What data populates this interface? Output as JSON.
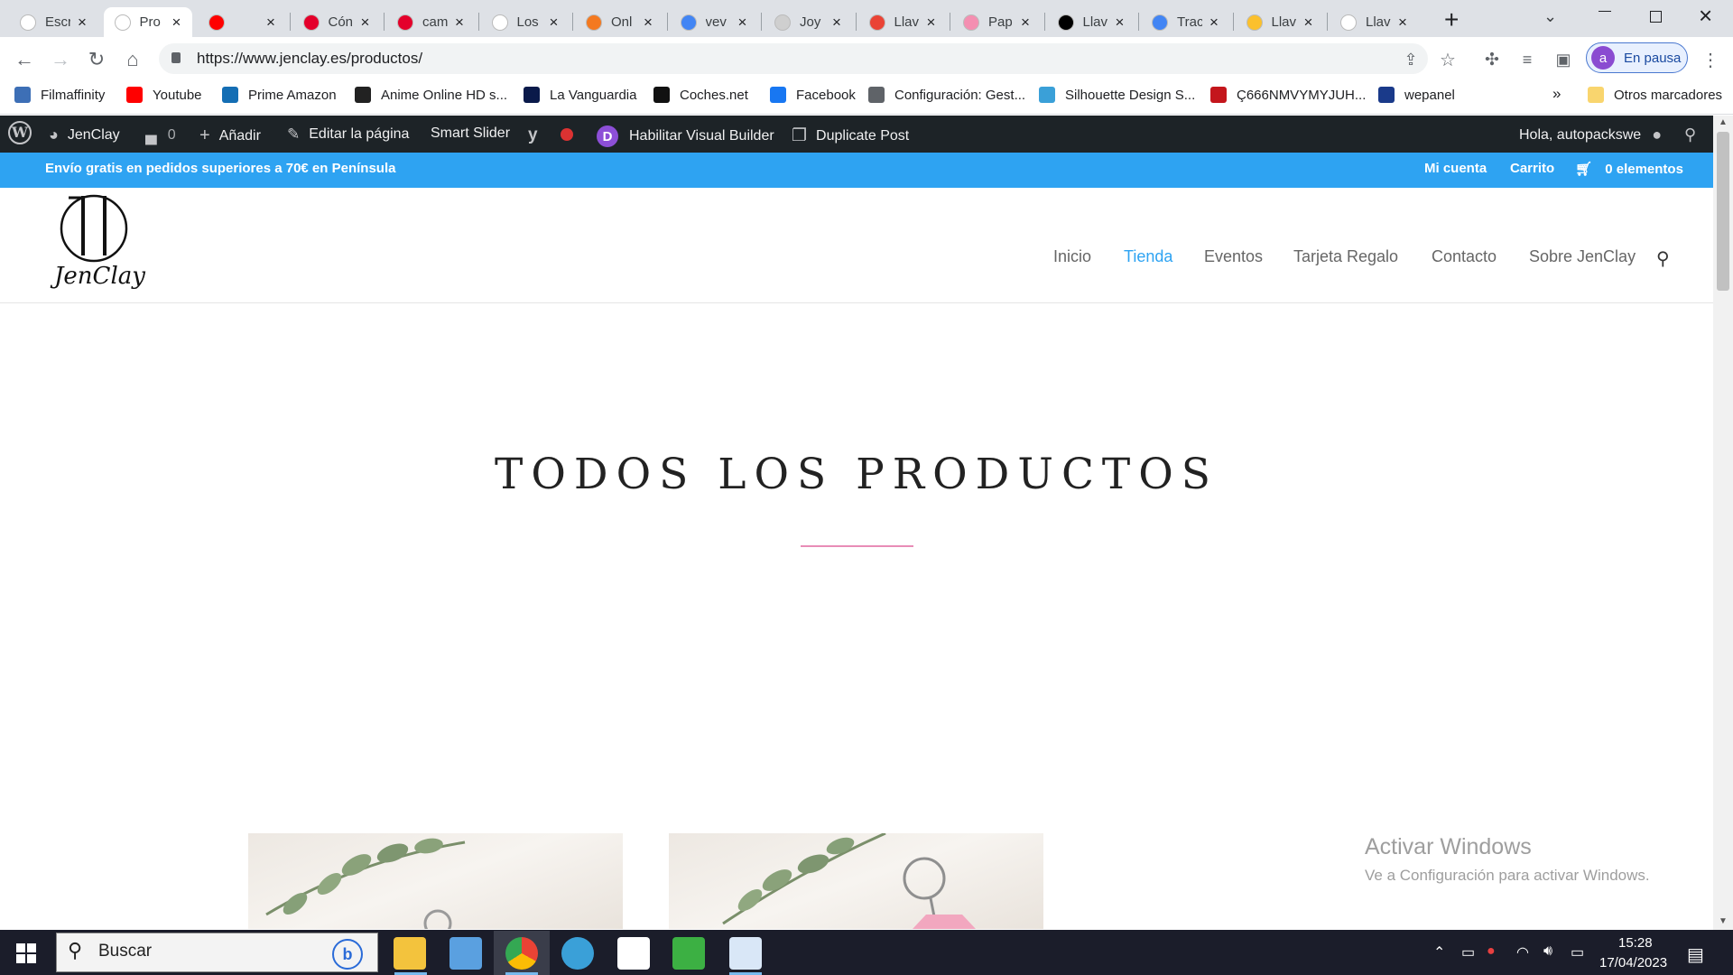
{
  "browser": {
    "tabs": [
      {
        "title": "Escr",
        "color": "#ffffff",
        "active": false
      },
      {
        "title": "Pro",
        "color": "#ffffff",
        "active": true
      },
      {
        "title": "",
        "color": "#ff0000",
        "active": false
      },
      {
        "title": "Cón",
        "color": "#e4002b",
        "active": false
      },
      {
        "title": "cam",
        "color": "#e4002b",
        "active": false
      },
      {
        "title": "Los",
        "color": "#ffffff",
        "active": false
      },
      {
        "title": "Onl",
        "color": "#f47920",
        "active": false
      },
      {
        "title": "vev",
        "color": "#4285f4",
        "active": false
      },
      {
        "title": "Joy",
        "color": "#cfcfcf",
        "active": false
      },
      {
        "title": "Llav",
        "color": "#ea4335",
        "active": false
      },
      {
        "title": "Pap",
        "color": "#f48fb1",
        "active": false
      },
      {
        "title": "Llav",
        "color": "#000000",
        "active": false
      },
      {
        "title": "Trac",
        "color": "#4285f4",
        "active": false
      },
      {
        "title": "Llav",
        "color": "#fbc02d",
        "active": false
      },
      {
        "title": "Llav",
        "color": "#ffffff",
        "active": false
      }
    ],
    "url": "https://www.jenclay.es/productos/",
    "profile_label": "En pausa",
    "profile_initial": "a",
    "bookmarks": [
      {
        "label": "Filmaffinity",
        "color": "#3d6fb6"
      },
      {
        "label": "Youtube",
        "color": "#ff0000"
      },
      {
        "label": "Prime Amazon",
        "color": "#146eb4"
      },
      {
        "label": "Anime Online HD s...",
        "color": "#222222"
      },
      {
        "label": "La Vanguardia",
        "color": "#0a1a4a"
      },
      {
        "label": "Coches.net",
        "color": "#111111"
      },
      {
        "label": "Facebook",
        "color": "#1877f2"
      },
      {
        "label": "Configuración: Gest...",
        "color": "#5f6368"
      },
      {
        "label": "Silhouette Design S...",
        "color": "#3aa0d8"
      },
      {
        "label": "Ç666NMVYMYJUH...",
        "color": "#c4161c"
      },
      {
        "label": "wepanel",
        "color": "#1a3a8a"
      }
    ],
    "bookmarks_overflow": "»",
    "other_bookmarks": "Otros marcadores"
  },
  "wp_admin": {
    "site_name": "JenClay",
    "comments": "0",
    "add": "Añadir",
    "edit": "Editar la página",
    "smart_slider": "Smart Slider",
    "visual_builder": "Habilitar Visual Builder",
    "duplicate": "Duplicate Post",
    "greeting": "Hola, autopackswe"
  },
  "promo": {
    "text": "Envío gratis en pedidos superiores a 70€ en Península",
    "my_account": "Mi cuenta",
    "cart": "Carrito",
    "items": "0 elementos"
  },
  "site": {
    "logo_text": "JenClay",
    "nav": [
      "Inicio",
      "Tienda",
      "Eventos",
      "Tarjeta Regalo",
      "Contacto",
      "Sobre JenClay"
    ],
    "active_nav": "Tienda",
    "page_title": "TODOS LOS PRODUCTOS"
  },
  "watermark": {
    "line1": "Activar Windows",
    "line2": "Ve a Configuración para activar Windows."
  },
  "taskbar": {
    "search_placeholder": "Buscar",
    "time": "15:28",
    "date": "17/04/2023"
  }
}
